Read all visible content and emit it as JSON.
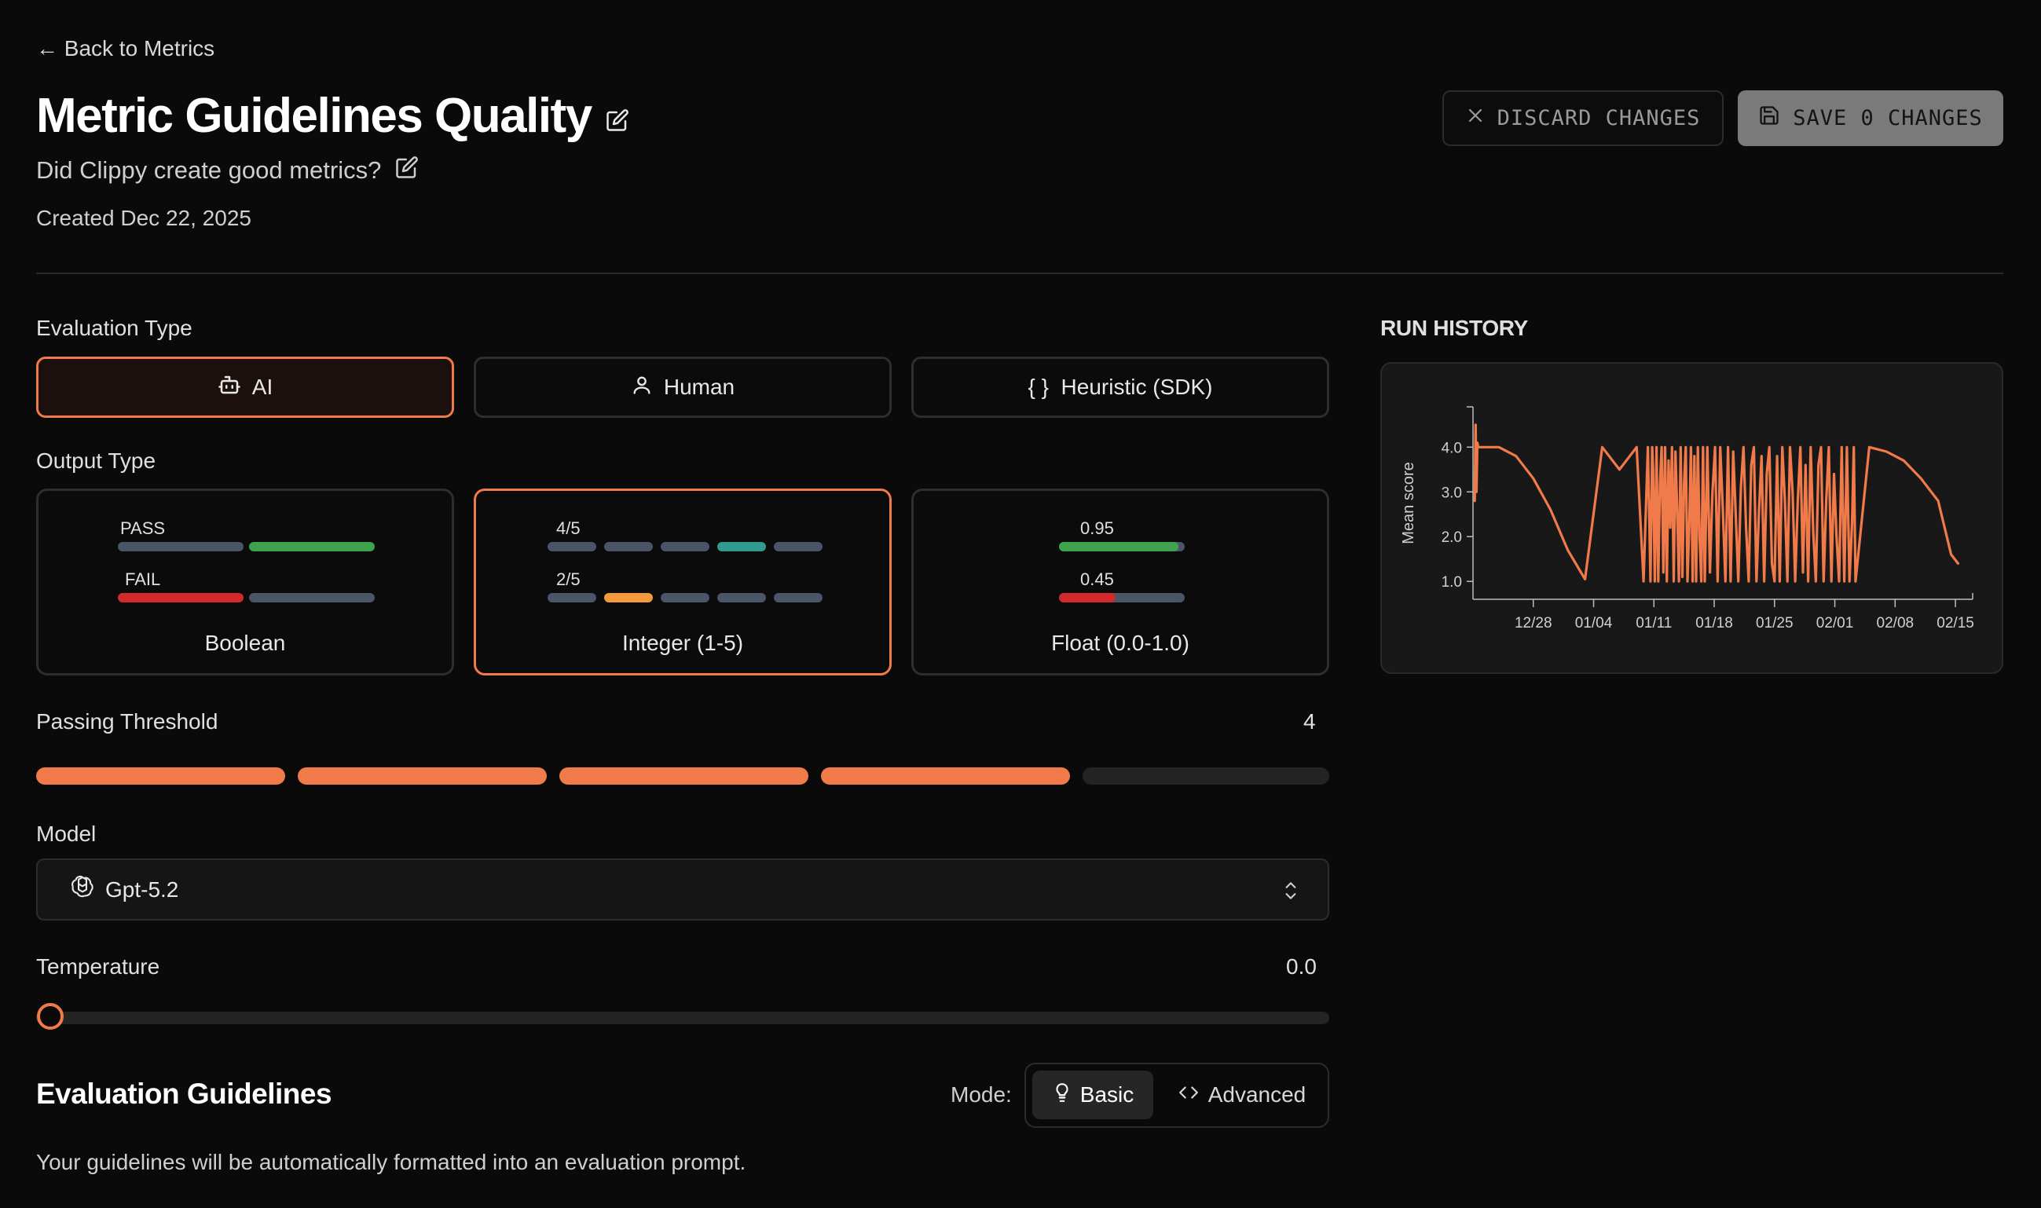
{
  "header": {
    "back_label": "← Back to Metrics",
    "title": "Metric Guidelines Quality",
    "subtitle": "Did Clippy create good metrics?",
    "created": "Created Dec 22, 2025",
    "discard_label": "DISCARD CHANGES",
    "save_label": "SAVE 0 CHANGES"
  },
  "evaluation_type": {
    "label": "Evaluation Type",
    "options": [
      {
        "label": "AI",
        "icon": "bot-icon",
        "selected": true
      },
      {
        "label": "Human",
        "icon": "user-icon",
        "selected": false
      },
      {
        "label": "{ }  Heuristic (SDK)",
        "icon": "braces-icon",
        "selected": false
      }
    ]
  },
  "output_type": {
    "label": "Output Type",
    "options": [
      {
        "label": "Boolean",
        "pass_label": "PASS",
        "fail_label": "FAIL",
        "selected": false
      },
      {
        "label": "Integer (1-5)",
        "top_label": "4/5",
        "bottom_label": "2/5",
        "selected": true
      },
      {
        "label": "Float (0.0-1.0)",
        "top_label": "0.95",
        "bottom_label": "0.45",
        "top_value": 0.95,
        "bottom_value": 0.45,
        "selected": false
      }
    ]
  },
  "threshold": {
    "label": "Passing Threshold",
    "value_text": "4",
    "value": 4,
    "max": 5
  },
  "model": {
    "label": "Model",
    "value": "Gpt-5.2"
  },
  "temperature": {
    "label": "Temperature",
    "value_text": "0.0",
    "value": 0.0
  },
  "guidelines": {
    "title": "Evaluation Guidelines",
    "mode_label": "Mode:",
    "basic_label": "Basic",
    "advanced_label": "Advanced",
    "description": "Your guidelines will be automatically formatted into an evaluation prompt."
  },
  "run_history": {
    "title": "RUN HISTORY"
  },
  "colors": {
    "accent": "#f07a4a",
    "pass": "#3fa34d",
    "fail": "#d22a2a",
    "neutral_bar": "#4a5568",
    "teal": "#2f9a8f",
    "orange_bar": "#f29a3c"
  },
  "chart_data": {
    "type": "line",
    "ylabel": "Mean score",
    "xlabel": "",
    "ylim": [
      0.6,
      4.9
    ],
    "yticks": [
      "1.0",
      "2.0",
      "3.0",
      "4.0"
    ],
    "ytick_values": [
      1.0,
      2.0,
      3.0,
      4.0
    ],
    "xticks": [
      "12/28",
      "01/04",
      "01/11",
      "01/18",
      "01/25",
      "02/01",
      "02/08",
      "02/15"
    ],
    "xtick_values": [
      7,
      14,
      21,
      28,
      35,
      42,
      49,
      56
    ],
    "x_axis_start": "12/22",
    "xlim": [
      0,
      58
    ],
    "series": [
      {
        "x": [
          0.2,
          0.3,
          0.4,
          0.5,
          0.6,
          1.0,
          3.0,
          5.0,
          7.0,
          9.0,
          11.0,
          13.0,
          15.0,
          17.0,
          19.0,
          19.8,
          20.3,
          20.6,
          20.8,
          20.9,
          21.1,
          21.3,
          21.5,
          21.7,
          21.9,
          22.1,
          22.3,
          22.5,
          22.7,
          22.9,
          23.1,
          23.3,
          23.5,
          23.7,
          23.9,
          24.1,
          24.3,
          24.5,
          24.7,
          24.9,
          25.1,
          25.3,
          25.5,
          25.7,
          25.9,
          26.1,
          26.3,
          26.5,
          26.7,
          26.9,
          27.2,
          27.5,
          27.8,
          28.1,
          28.4,
          28.7,
          29.0,
          29.3,
          29.6,
          29.9,
          30.2,
          30.5,
          30.8,
          31.1,
          31.4,
          31.7,
          32.0,
          32.3,
          32.6,
          32.9,
          33.2,
          33.5,
          33.8,
          34.1,
          34.4,
          34.7,
          35.0,
          35.3,
          35.6,
          35.9,
          36.2,
          36.5,
          36.8,
          37.1,
          37.4,
          37.7,
          38.0,
          38.3,
          38.6,
          38.9,
          39.2,
          39.5,
          39.8,
          40.1,
          40.4,
          40.7,
          41.0,
          41.3,
          41.6,
          41.9,
          42.2,
          42.5,
          42.8,
          43.1,
          43.4,
          43.7,
          44.0,
          44.2,
          44.4,
          46.0,
          48.0,
          50.0,
          52.0,
          54.0,
          55.5,
          56.3
        ],
        "y": [
          2.8,
          4.5,
          3.0,
          4.1,
          4.0,
          4.0,
          4.0,
          3.8,
          3.3,
          2.6,
          1.7,
          1.05,
          4.0,
          3.5,
          4.0,
          1.0,
          4.0,
          1.0,
          4.0,
          3.5,
          1.0,
          4.0,
          1.0,
          3.2,
          4.0,
          1.2,
          4.0,
          1.0,
          3.7,
          2.2,
          4.0,
          1.0,
          3.9,
          2.6,
          1.0,
          4.0,
          1.1,
          3.2,
          4.0,
          1.0,
          2.2,
          4.0,
          1.0,
          3.8,
          1.0,
          4.0,
          2.0,
          1.0,
          4.0,
          1.0,
          4.0,
          1.2,
          3.0,
          4.0,
          1.0,
          4.0,
          2.6,
          1.0,
          4.0,
          1.0,
          3.9,
          2.5,
          1.0,
          3.1,
          4.0,
          2.2,
          1.0,
          3.6,
          4.0,
          1.0,
          2.6,
          3.8,
          1.0,
          3.4,
          4.0,
          1.4,
          1.0,
          3.8,
          1.0,
          4.0,
          2.8,
          1.0,
          4.0,
          3.0,
          1.0,
          2.8,
          4.0,
          1.2,
          3.6,
          1.0,
          4.0,
          2.1,
          1.0,
          3.6,
          4.0,
          1.0,
          2.8,
          4.0,
          1.0,
          3.4,
          2.0,
          1.0,
          4.0,
          1.0,
          4.0,
          1.0,
          2.3,
          4.0,
          1.0,
          4.0,
          3.9,
          3.7,
          3.3,
          2.8,
          1.6,
          1.4
        ]
      }
    ]
  }
}
